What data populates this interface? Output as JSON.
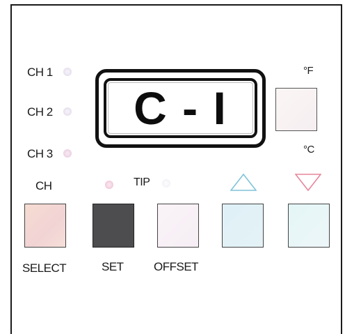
{
  "channels": [
    {
      "label": "CH 1"
    },
    {
      "label": "CH 2"
    },
    {
      "label": "CH 3"
    }
  ],
  "display": {
    "text": "C - I"
  },
  "units": {
    "fahrenheit": "°F",
    "celsius": "°C"
  },
  "ch_label": "CH",
  "tip_label": "TIP",
  "buttons": {
    "select": "SELECT",
    "set": "SET",
    "offset": "OFFSET"
  },
  "colors": {
    "set_button": "#4d4d4f",
    "arrow_up": "#7fc3d8",
    "arrow_down": "#e7859a"
  },
  "icons": {
    "up": "triangle-up-icon",
    "down": "triangle-down-icon"
  }
}
